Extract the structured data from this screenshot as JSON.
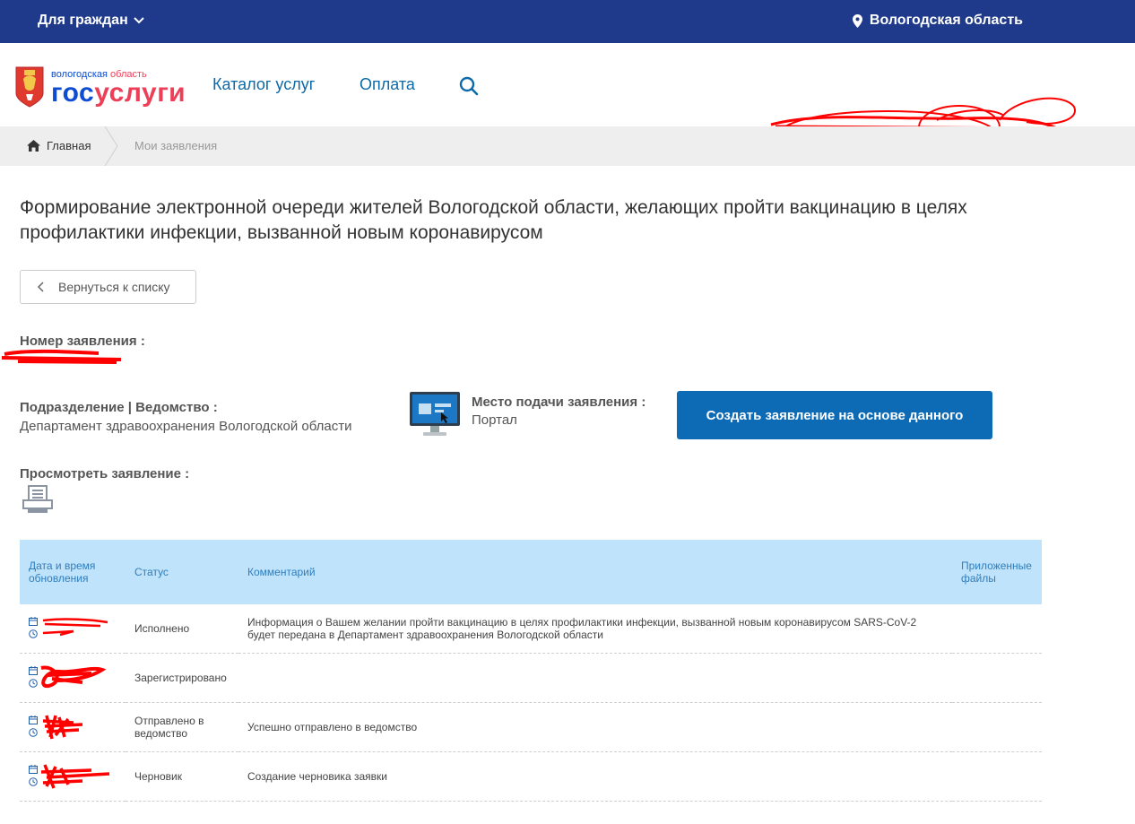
{
  "topbar": {
    "audience": "Для граждан",
    "region": "Вологодская область"
  },
  "header": {
    "logo_small_part1": "вологодская ",
    "logo_small_part2": "область",
    "logo_big_part1": "гос",
    "logo_big_part2": "услуги",
    "nav": [
      "Каталог услуг",
      "Оплата"
    ]
  },
  "breadcrumbs": {
    "home": "Главная",
    "current": "Мои заявления"
  },
  "page": {
    "title": "Формирование электронной очереди жителей Вологодской области, желающих пройти вакцинацию в целях профилактики инфекции, вызванной новым коронавирусом",
    "back_button": "Вернуться к списку",
    "application_number_label": "Номер заявления :",
    "department_label": "Подразделение | Ведомство :",
    "department_value": "Департамент здравоохранения Вологодской области",
    "submission_place_label": "Место подачи заявления :",
    "submission_place_value": "Портал",
    "create_button": "Создать заявление на основе данного",
    "view_label": "Просмотреть заявление :"
  },
  "history": {
    "headers": {
      "date": "Дата и время обновления",
      "status": "Статус",
      "comment": "Комментарий",
      "files": "Приложенные файлы"
    },
    "rows": [
      {
        "status": "Исполнено",
        "comment": "Информация о Вашем желании пройти вакцинацию в целях профилактики инфекции, вызванной новым коронавирусом SARS-CoV-2 будет передана в Департамент здравоохранения Вологодской области"
      },
      {
        "status": "Зарегистрировано",
        "comment": ""
      },
      {
        "status": "Отправлено в ведомство",
        "comment": "Успешно отправлено в ведомство"
      },
      {
        "status": "Черновик",
        "comment": "Создание черновика заявки"
      }
    ]
  },
  "colors": {
    "topbar": "#1f3a8a",
    "primary_button": "#0d6ab5",
    "table_header": "#bfe3fa",
    "redaction": "#ff0000"
  }
}
